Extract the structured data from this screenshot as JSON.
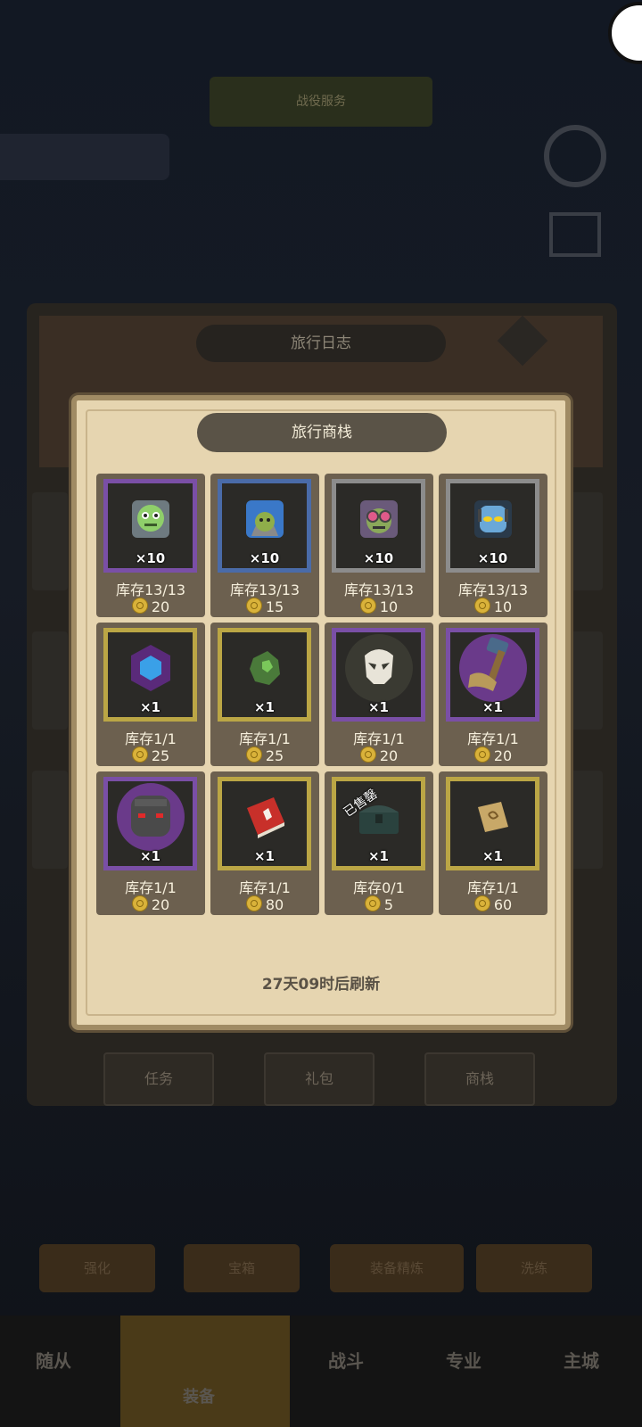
{
  "background": {
    "banner_title": "战役服务",
    "banner_sub": "",
    "left_pill": "",
    "right_text": "",
    "journal_title": "旅行日志",
    "tabs": [
      "任务",
      "礼包",
      "商栈"
    ],
    "lower_row": [
      "强化",
      "宝箱",
      "装备精炼",
      "洗练"
    ],
    "nav": [
      "随从",
      "装备",
      "战斗",
      "专业",
      "主城"
    ]
  },
  "shop": {
    "title": "旅行商栈",
    "refresh_text": "27天09时后刷新",
    "items": [
      {
        "icon": "zombie-head-icon",
        "frame": "purple",
        "qty": "×10",
        "stock": "库存13/13",
        "price": "20"
      },
      {
        "icon": "hooded-goblin-icon",
        "frame": "blue",
        "qty": "×10",
        "stock": "库存13/13",
        "price": "15"
      },
      {
        "icon": "goggles-goblin-icon",
        "frame": "grey",
        "qty": "×10",
        "stock": "库存13/13",
        "price": "10"
      },
      {
        "icon": "robot-head-icon",
        "frame": "grey",
        "qty": "×10",
        "stock": "库存13/13",
        "price": "10"
      },
      {
        "icon": "blue-gem-icon",
        "frame": "gold",
        "qty": "×1",
        "stock": "库存1/1",
        "price": "25"
      },
      {
        "icon": "green-ore-icon",
        "frame": "gold",
        "qty": "×1",
        "stock": "库存1/1",
        "price": "25"
      },
      {
        "icon": "skull-mask-icon",
        "frame": "purple",
        "qty": "×1",
        "stock": "库存1/1",
        "price": "20"
      },
      {
        "icon": "hammer-arm-icon",
        "frame": "purple",
        "qty": "×1",
        "stock": "库存1/1",
        "price": "20"
      },
      {
        "icon": "golem-head-icon",
        "frame": "purple",
        "qty": "×1",
        "stock": "库存1/1",
        "price": "20"
      },
      {
        "icon": "red-book-icon",
        "frame": "gold",
        "qty": "×1",
        "stock": "库存1/1",
        "price": "80"
      },
      {
        "icon": "treasure-chest-icon",
        "frame": "gold",
        "qty": "×1",
        "stock": "库存0/1",
        "price": "5",
        "sold": "已售罄"
      },
      {
        "icon": "scroll-icon",
        "frame": "gold",
        "qty": "×1",
        "stock": "库存1/1",
        "price": "60"
      }
    ]
  }
}
